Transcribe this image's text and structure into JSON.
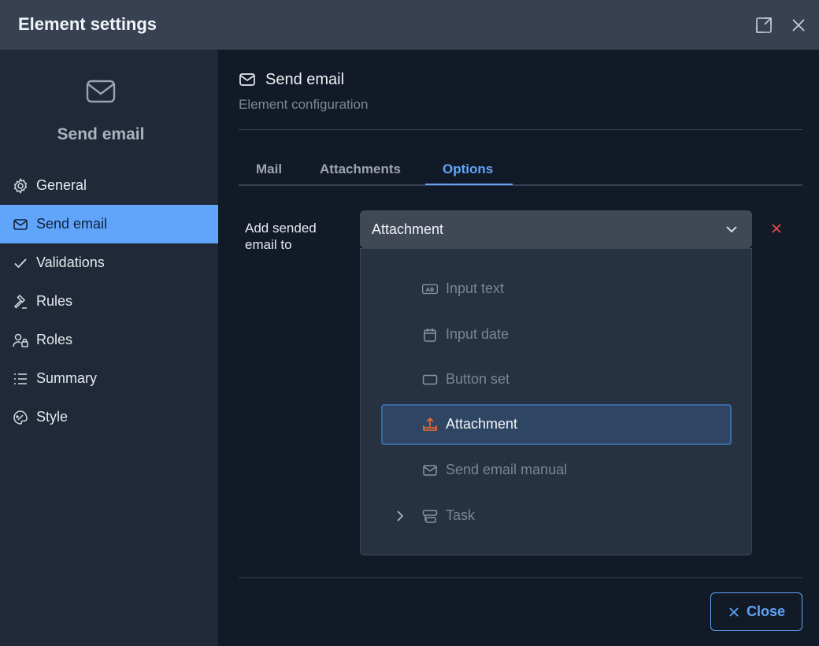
{
  "window": {
    "title": "Element settings",
    "expand_icon": "expand-icon",
    "close_icon": "close-icon"
  },
  "sidebar": {
    "header_icon": "envelope-icon",
    "header_title": "Send email",
    "items": [
      {
        "label": "General",
        "icon": "gear-icon"
      },
      {
        "label": "Send email",
        "icon": "envelope-icon",
        "active": true
      },
      {
        "label": "Validations",
        "icon": "check-icon"
      },
      {
        "label": "Rules",
        "icon": "gavel-icon"
      },
      {
        "label": "Roles",
        "icon": "user-lock-icon"
      },
      {
        "label": "Summary",
        "icon": "list-icon"
      },
      {
        "label": "Style",
        "icon": "palette-icon"
      }
    ]
  },
  "main": {
    "title": "Send email",
    "subtitle": "Element configuration",
    "tabs": [
      {
        "label": "Mail"
      },
      {
        "label": "Attachments"
      },
      {
        "label": "Options",
        "active": true
      }
    ],
    "field": {
      "label": "Add sended email to",
      "selected_value": "Attachment"
    },
    "dropdown": {
      "options": [
        {
          "label": "Input text",
          "icon": "input-text-icon"
        },
        {
          "label": "Input date",
          "icon": "calendar-icon"
        },
        {
          "label": "Button set",
          "icon": "button-icon"
        },
        {
          "label": "Attachment",
          "icon": "upload-icon",
          "selected": true
        },
        {
          "label": "Send email manual",
          "icon": "envelope-icon"
        },
        {
          "label": "Task",
          "icon": "task-icon",
          "expandable": true
        }
      ]
    },
    "close_button": "Close"
  },
  "colors": {
    "accent": "#60a5fa",
    "danger": "#e04848",
    "attachment_icon": "#f06a2a"
  }
}
